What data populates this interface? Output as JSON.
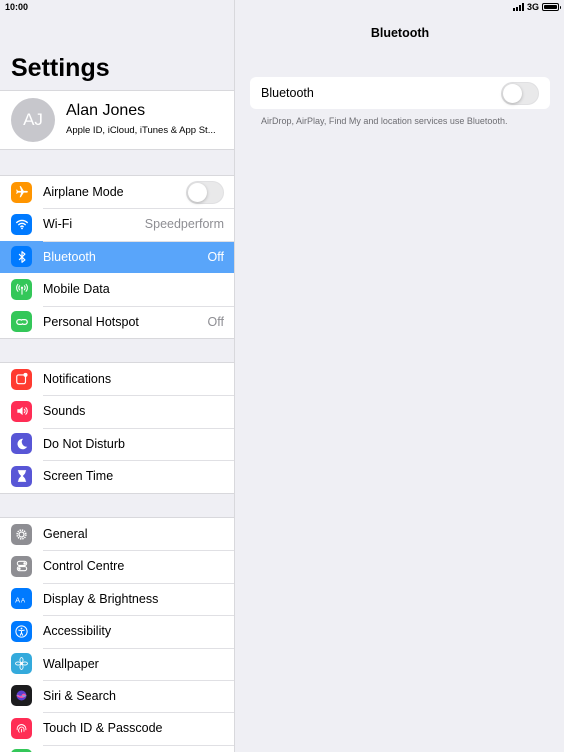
{
  "status_bar": {
    "time": "10:00",
    "network": "3G"
  },
  "left": {
    "title": "Settings",
    "profile": {
      "initials": "AJ",
      "name": "Alan Jones",
      "subtitle": "Apple ID, iCloud, iTunes & App St..."
    },
    "group1": [
      {
        "label": "Airplane Mode",
        "icon": "airplane-icon",
        "color": "#ff9500",
        "toggle": "off"
      },
      {
        "label": "Wi-Fi",
        "icon": "wifi-icon",
        "color": "#007aff",
        "value": "Speedperform"
      },
      {
        "label": "Bluetooth",
        "icon": "bluetooth-icon",
        "color": "#007aff",
        "value": "Off",
        "selected": true
      },
      {
        "label": "Mobile Data",
        "icon": "antenna-icon",
        "color": "#34c759"
      },
      {
        "label": "Personal Hotspot",
        "icon": "hotspot-icon",
        "color": "#34c759",
        "value": "Off"
      }
    ],
    "group2": [
      {
        "label": "Notifications",
        "icon": "notifications-icon",
        "color": "#ff3b30"
      },
      {
        "label": "Sounds",
        "icon": "speaker-icon",
        "color": "#ff2d55"
      },
      {
        "label": "Do Not Disturb",
        "icon": "moon-icon",
        "color": "#5856d6"
      },
      {
        "label": "Screen Time",
        "icon": "hourglass-icon",
        "color": "#5856d6"
      }
    ],
    "group3": [
      {
        "label": "General",
        "icon": "gear-icon",
        "color": "#8e8e93"
      },
      {
        "label": "Control Centre",
        "icon": "switches-icon",
        "color": "#8e8e93"
      },
      {
        "label": "Display & Brightness",
        "icon": "text-size-icon",
        "color": "#007aff"
      },
      {
        "label": "Accessibility",
        "icon": "accessibility-icon",
        "color": "#007aff"
      },
      {
        "label": "Wallpaper",
        "icon": "flower-icon",
        "color": "#34aadc"
      },
      {
        "label": "Siri & Search",
        "icon": "siri-icon",
        "color": "#1c1c1e"
      },
      {
        "label": "Touch ID & Passcode",
        "icon": "fingerprint-icon",
        "color": "#ff2d55"
      }
    ]
  },
  "right": {
    "title": "Bluetooth",
    "bluetooth_label": "Bluetooth",
    "bluetooth_toggle": "off",
    "footer": "AirDrop, AirPlay, Find My and location services use Bluetooth."
  }
}
